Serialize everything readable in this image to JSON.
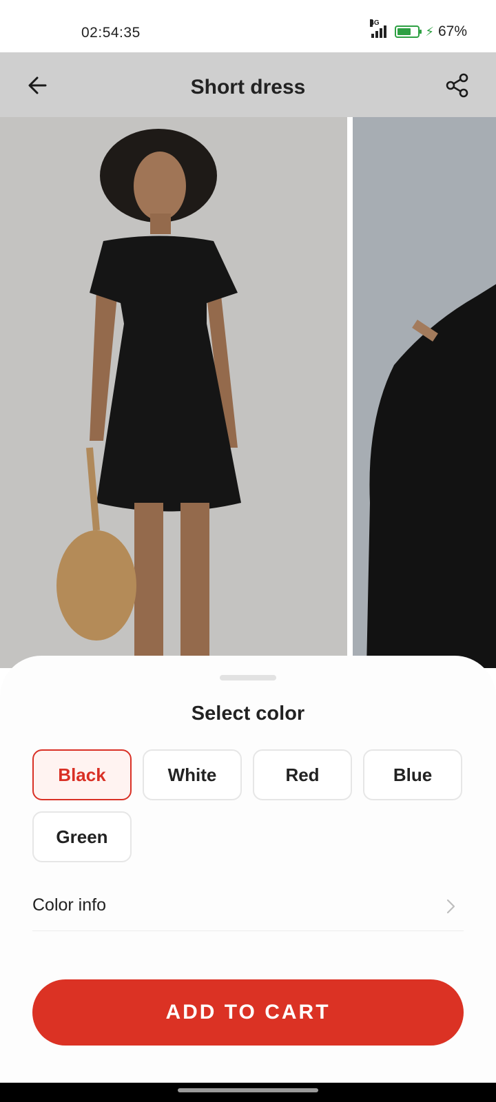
{
  "status_bar": {
    "time": "02:54:35",
    "network": "4G",
    "battery_percent": "67%",
    "battery_level": 0.67
  },
  "header": {
    "title": "Short dress",
    "back_icon": "arrow-left-icon",
    "share_icon": "share-icon"
  },
  "gallery": {
    "images": [
      "dress-front-photo",
      "dress-detail-photo"
    ]
  },
  "sheet": {
    "title": "Select color",
    "colors": [
      {
        "label": "Black",
        "selected": true
      },
      {
        "label": "White",
        "selected": false
      },
      {
        "label": "Red",
        "selected": false
      },
      {
        "label": "Blue",
        "selected": false
      },
      {
        "label": "Green",
        "selected": false
      }
    ],
    "color_info_label": "Color info",
    "add_to_cart_label": "ADD TO CART"
  },
  "colors": {
    "accent": "#db3224",
    "selected_chip_bg": "#fff3f1",
    "header_bg": "#cfcfcf"
  }
}
